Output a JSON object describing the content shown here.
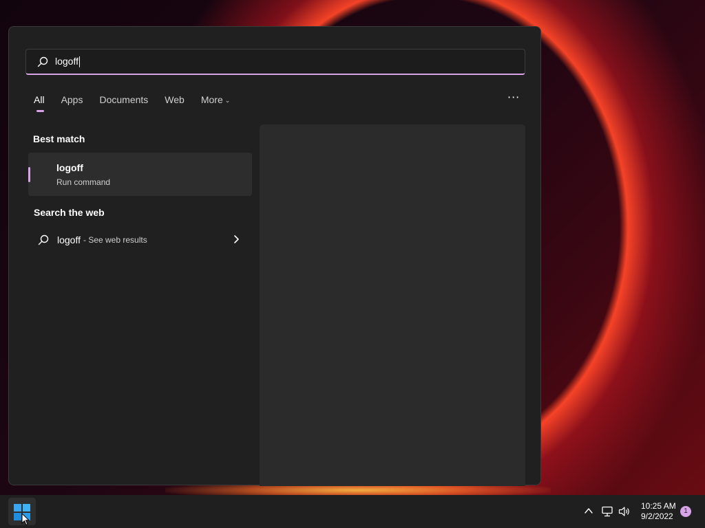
{
  "search": {
    "query": "logoff"
  },
  "tabs": [
    {
      "label": "All",
      "active": true
    },
    {
      "label": "Apps"
    },
    {
      "label": "Documents"
    },
    {
      "label": "Web"
    },
    {
      "label": "More"
    }
  ],
  "more_options_icon": "more-dots-icon",
  "best_match": {
    "title": "Best match",
    "item": {
      "name": "logoff",
      "subtitle": "Run command"
    }
  },
  "web": {
    "title": "Search the web",
    "query": "logoff",
    "hint": "- See web results"
  },
  "taskbar": {
    "time": "10:25 AM",
    "date": "9/2/2022",
    "notification_count": "1"
  },
  "colors": {
    "accent": "#d9a3e8",
    "panel": "#202020",
    "taskbar": "#1f1f1f"
  }
}
